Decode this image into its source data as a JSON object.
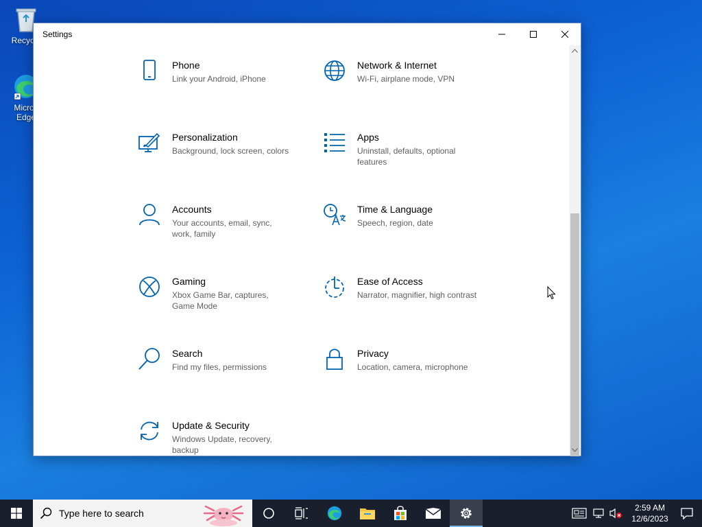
{
  "desktop": {
    "icons": [
      {
        "label": "Recycle"
      },
      {
        "label": "Micros Edge"
      }
    ]
  },
  "window": {
    "title": "Settings",
    "controls": {
      "minimize": "minimize-icon",
      "maximize": "maximize-icon",
      "close": "close-icon"
    }
  },
  "settings": {
    "tiles": [
      {
        "name": "Phone",
        "desc": "Link your Android, iPhone",
        "icon": "phone-icon"
      },
      {
        "name": "Network & Internet",
        "desc": "Wi-Fi, airplane mode, VPN",
        "icon": "globe-icon"
      },
      {
        "name": "Personalization",
        "desc": "Background, lock screen, colors",
        "icon": "paint-icon"
      },
      {
        "name": "Apps",
        "desc": "Uninstall, defaults, optional features",
        "icon": "apps-list-icon"
      },
      {
        "name": "Accounts",
        "desc": "Your accounts, email, sync, work, family",
        "icon": "person-icon"
      },
      {
        "name": "Time & Language",
        "desc": "Speech, region, date",
        "icon": "time-language-icon"
      },
      {
        "name": "Gaming",
        "desc": "Xbox Game Bar, captures, Game Mode",
        "icon": "xbox-icon"
      },
      {
        "name": "Ease of Access",
        "desc": "Narrator, magnifier, high contrast",
        "icon": "ease-of-access-icon"
      },
      {
        "name": "Search",
        "desc": "Find my files, permissions",
        "icon": "search-icon"
      },
      {
        "name": "Privacy",
        "desc": "Location, camera, microphone",
        "icon": "lock-icon"
      },
      {
        "name": "Update & Security",
        "desc": "Windows Update, recovery, backup",
        "icon": "sync-icon"
      }
    ]
  },
  "taskbar": {
    "search_placeholder": "Type here to search",
    "clock_time": "2:59 AM",
    "clock_date": "12/6/2023"
  },
  "colors": {
    "accent": "#0063b1",
    "taskbar": "#1a1f2e"
  }
}
